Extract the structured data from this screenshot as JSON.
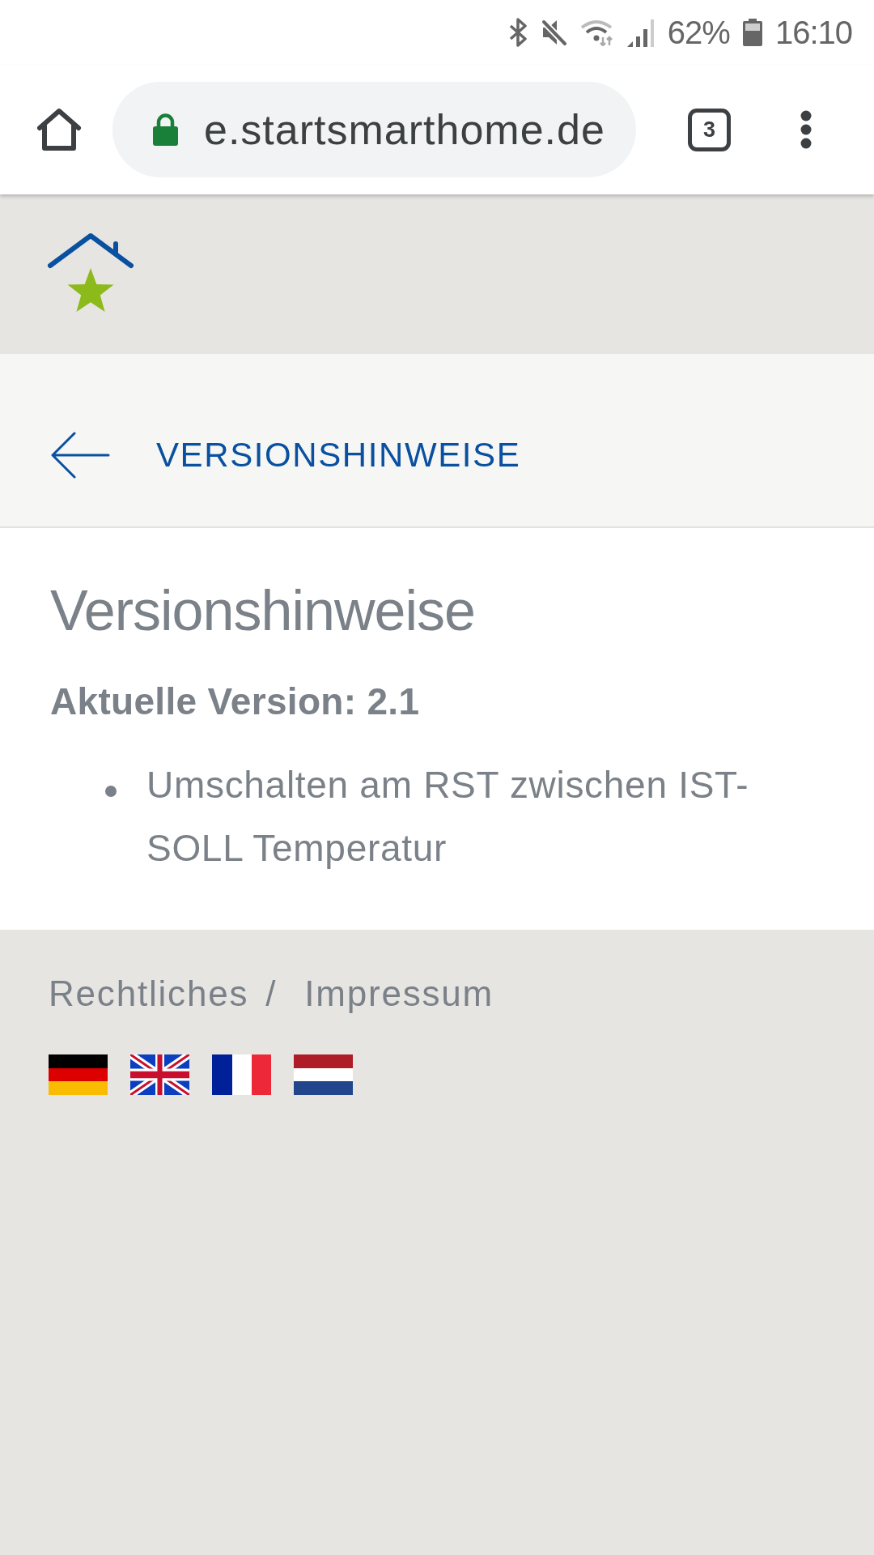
{
  "status_bar": {
    "battery": "62%",
    "time": "16:10"
  },
  "browser": {
    "secure": true,
    "url": "e.startsmarthome.de",
    "tab_count": "3"
  },
  "page_header": {
    "title": "VERSIONSHINWEISE"
  },
  "content": {
    "heading": "Versionshinweise",
    "current_version": "Aktuelle Version: 2.1",
    "notes": [
      "Umschalten am RST zwischen IST-SOLL Temperatur"
    ]
  },
  "footer": {
    "links": [
      "Rechtliches",
      "Impressum"
    ],
    "separator": "/",
    "flags": [
      {
        "kind": "german"
      },
      {
        "kind": "british"
      },
      {
        "kind": "french"
      },
      {
        "kind": "dutch"
      }
    ]
  }
}
